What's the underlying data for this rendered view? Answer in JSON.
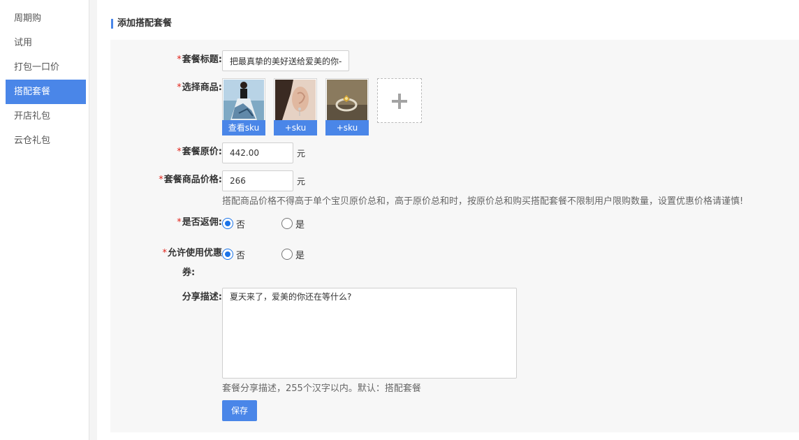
{
  "sidebar": {
    "items": [
      {
        "label": "周期购",
        "active": false
      },
      {
        "label": "试用",
        "active": false
      },
      {
        "label": "打包一口价",
        "active": false
      },
      {
        "label": "搭配套餐",
        "active": true
      },
      {
        "label": "开店礼包",
        "active": false
      },
      {
        "label": "云仓礼包",
        "active": false
      }
    ]
  },
  "section": {
    "title": "添加搭配套餐"
  },
  "form": {
    "required_mark": "*",
    "title": {
      "label": "套餐标题:",
      "value": "把最真挚的美好送给爱美的你-"
    },
    "products": {
      "label": "选择商品:",
      "items": [
        {
          "sku_label": "查看sku",
          "picture": "woman-floral-skirt-photo"
        },
        {
          "sku_label": "+sku",
          "picture": "earring-photo"
        },
        {
          "sku_label": "+sku",
          "picture": "ring-photo"
        }
      ],
      "add_icon": "plus-icon"
    },
    "original_price": {
      "label": "套餐原价:",
      "value": "442.00",
      "unit": "元"
    },
    "package_price": {
      "label": "套餐商品价格:",
      "value": "266",
      "unit": "元",
      "hint": "搭配商品价格不得高于单个宝贝原价总和，高于原价总和时，按原价总和购买搭配套餐不限制用户限购数量，设置优惠价格请谨慎!"
    },
    "commission": {
      "label": "是否返佣:",
      "options": [
        "否",
        "是"
      ],
      "selected": "否"
    },
    "coupon": {
      "label_line1": "允许使用优惠",
      "label_line2": "券:",
      "options": [
        "否",
        "是"
      ],
      "selected": "否"
    },
    "share": {
      "label": "分享描述:",
      "value": "夏天来了，爱美的你还在等什么?",
      "hint": "套餐分享描述，255个汉字以内。默认：搭配套餐"
    },
    "save_label": "保存"
  },
  "colors": {
    "accent": "#4a86e8",
    "required": "#e2231a",
    "radio": "#1a73e8"
  }
}
